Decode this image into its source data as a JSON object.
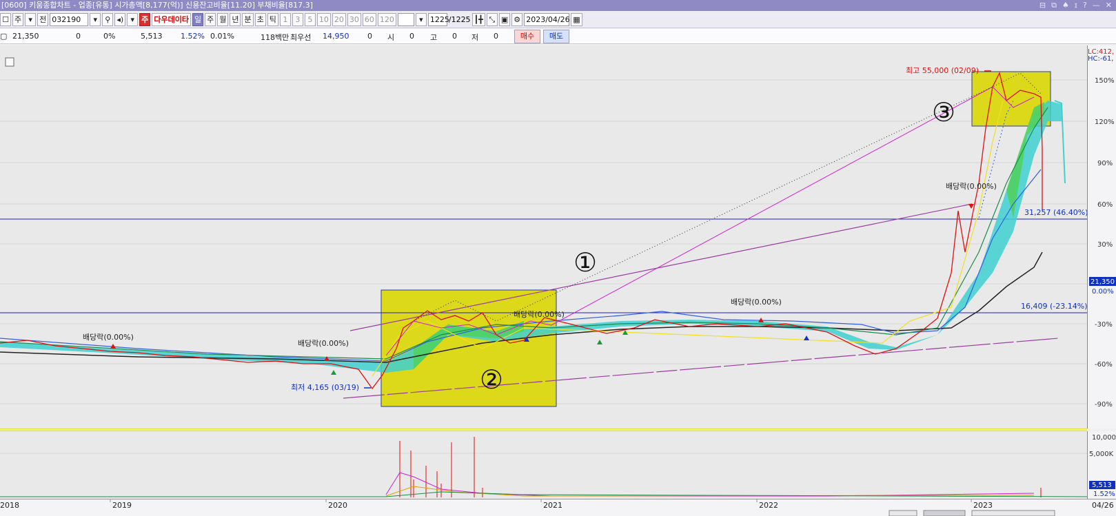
{
  "window": {
    "title": "[0600] 키움종합차트 - 업종[유통] 시가총액[8,177(억)] 신용잔고비율[11.20] 부채비율[817.3]",
    "controls": [
      "⊟",
      "⧉",
      "♠",
      "ɪ",
      "?",
      "—",
      "✕"
    ]
  },
  "toolbar": {
    "market": "주",
    "prev": "전",
    "code": "032190",
    "period_flag": "주",
    "datasource": "다우데이타",
    "periods": [
      "일",
      "주",
      "월",
      "년",
      "분",
      "초",
      "틱"
    ],
    "selected_period": "일",
    "intervals": [
      "1",
      "3",
      "5",
      "10",
      "20",
      "30",
      "60",
      "120"
    ],
    "count": "1225",
    "total": "/1225",
    "date": "2023/04/26"
  },
  "info": {
    "price": "21,350",
    "change": "0",
    "change_pct": "0%",
    "volume": "5,513",
    "vol_ratio": "1.52%",
    "turnover": "0.01%",
    "amount": "118백만",
    "pref_label": "최우선",
    "pref_price": "14,950",
    "pref_qty": "0",
    "open_label": "시",
    "open": "0",
    "high_label": "고",
    "high": "0",
    "low_label": "저",
    "low": "0",
    "buy": "매수",
    "sell": "매도"
  },
  "chart": {
    "lc": "LC:412,",
    "hc": "HC:-61,",
    "yticks": [
      "150%",
      "120%",
      "90%",
      "60%",
      "30%",
      "0.00%",
      "-30%",
      "-60%",
      "-90%"
    ],
    "price_tag": "21,350",
    "high_label": "최고 55,000 (02/09)",
    "low_label": "최저 4,165 (03/19)",
    "h1_label": "31,257 (46.40%)",
    "h2_label": "16,409 (-23.14%)",
    "dividend_label": "배당락(0.00%)",
    "circle1": "①",
    "circle2": "②",
    "circle3": "③"
  },
  "volume_axis": {
    "ticks": [
      "10,000",
      "5,000K"
    ],
    "last_vol": "5,513",
    "last_pct": "1.52%"
  },
  "xaxis": {
    "labels": [
      "2018",
      "2019",
      "2020",
      "2021",
      "2022",
      "2023"
    ],
    "end_label": "04/26"
  },
  "colors": {
    "title_bg": "#8f8ac4",
    "highlight_box": "#e4e100",
    "up": "#e01010",
    "down": "#1030d0",
    "hline": "#2020c0",
    "trend": "#9a3aa0",
    "cloud": "#40d0d0"
  }
}
